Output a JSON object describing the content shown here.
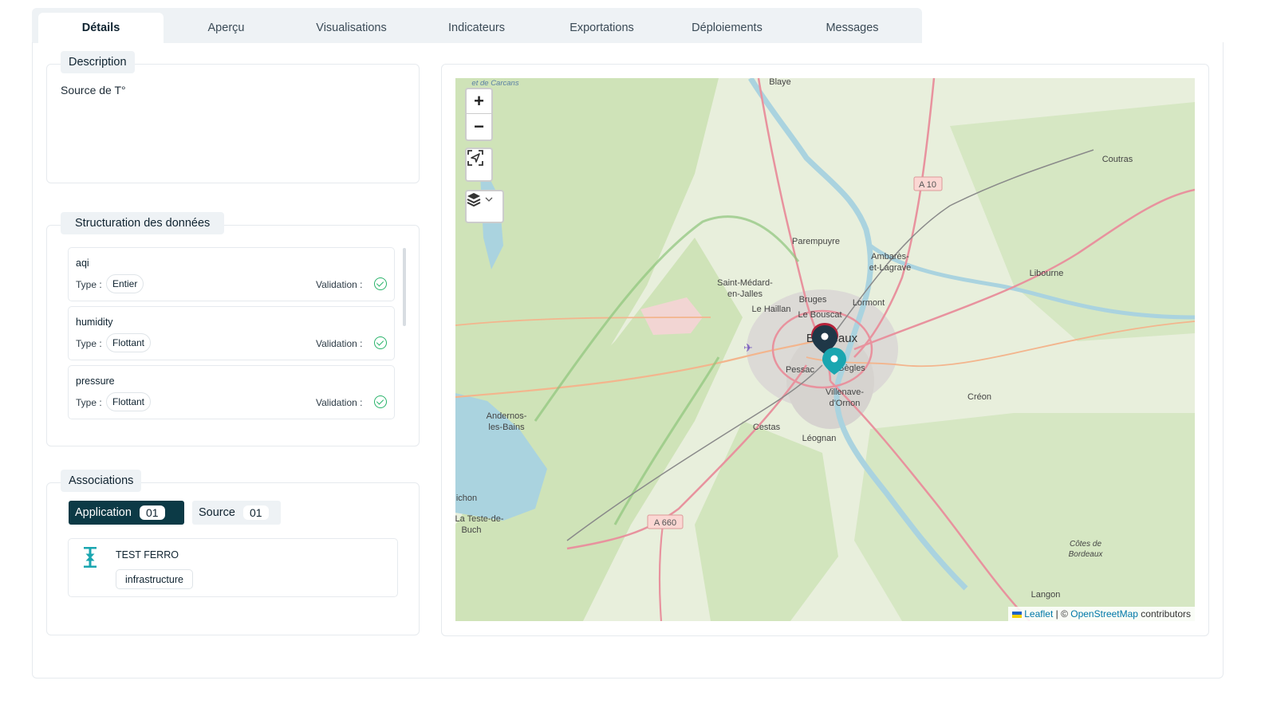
{
  "tabs": [
    "Détails",
    "Aperçu",
    "Visualisations",
    "Indicateurs",
    "Exportations",
    "Déploiements",
    "Messages"
  ],
  "description": {
    "legend": "Description",
    "text": "Source de T°"
  },
  "structuration": {
    "legend": "Structuration des données",
    "type_label": "Type :",
    "validation_label": "Validation :",
    "fields": [
      {
        "name": "aqi",
        "type": "Entier"
      },
      {
        "name": "humidity",
        "type": "Flottant"
      },
      {
        "name": "pressure",
        "type": "Flottant"
      }
    ]
  },
  "associations": {
    "legend": "Associations",
    "application_label": "Application",
    "application_count": "01",
    "source_label": "Source",
    "source_count": "01",
    "item_title": "TEST FERRO",
    "item_tag": "infrastructure"
  },
  "map": {
    "zoom_in": "+",
    "zoom_out": "−",
    "labels": {
      "blaye": "Blaye",
      "carcans": "et de Carcans",
      "coutras": "Coutras",
      "a10": "A 10",
      "parempuyre": "Parempuyre",
      "ambares1": "Ambarès-",
      "ambares2": "et-Lagrave",
      "libourne": "Libourne",
      "saint_medard1": "Saint-Médard-",
      "saint_medard2": "en-Jalles",
      "le_haillan": "Le Haillan",
      "bruges": "Bruges",
      "lormont": "Lormont",
      "le_bouscat": "Le Bouscat",
      "bordeaux": "Bordeaux",
      "pessac": "Pessac",
      "begles": "Bègles",
      "villenave1": "Villenave-",
      "villenave2": "d'Ornon",
      "creon": "Créon",
      "andernos1": "Andernos-",
      "andernos2": "les-Bains",
      "cestas": "Cestas",
      "leognan": "Léognan",
      "ichon": "ichon",
      "teste1": "La Teste-de-",
      "teste2": "Buch",
      "a660": "A 660",
      "cotes1": "Côtes de",
      "cotes2": "Bordeaux",
      "langon": "Langon"
    },
    "attribution": {
      "leaflet": "Leaflet",
      "sep": " | © ",
      "osm": "OpenStreetMap",
      "rest": " contributors"
    }
  },
  "colors": {
    "accent": "#0c3a46",
    "marker_dark": "#1f3747",
    "marker_teal": "#1aa6b0",
    "valid": "#29b36a"
  }
}
